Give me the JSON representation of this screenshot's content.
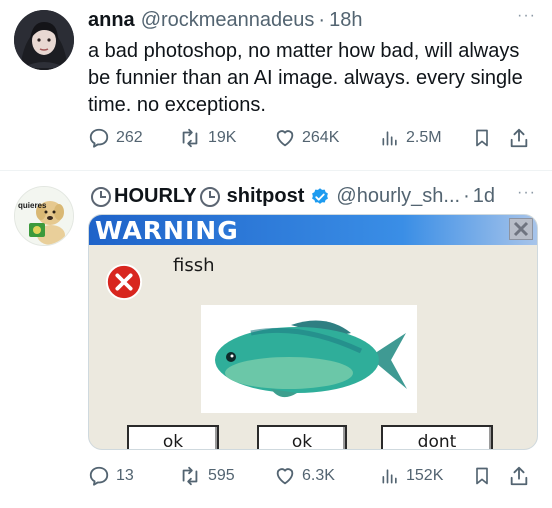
{
  "tweets": [
    {
      "author_name": "anna",
      "author_handle": "@rockmeannadeus",
      "separator": "·",
      "time": "18h",
      "text": "a bad photoshop, no matter how bad, will always be funnier than an AI image. always. every single time. no exceptions.",
      "stats": {
        "replies": "262",
        "retweets": "19K",
        "likes": "264K",
        "views": "2.5M"
      }
    },
    {
      "author_name": "HOURLY",
      "author_name_suffix": "shitpost",
      "author_handle": "@hourly_sh...",
      "separator": "·",
      "time": "1d",
      "avatar_text": "quieres",
      "stats": {
        "replies": "13",
        "retweets": "595",
        "likes": "6.3K",
        "views": "152K"
      },
      "meme": {
        "window_title": "WARNING",
        "message": "fissh",
        "buttons": [
          "ok",
          "ok",
          "dont"
        ]
      }
    }
  ],
  "more_label": "···",
  "colors": {
    "verified": "#1d9bf0",
    "title_bar": "#2a6fd6",
    "error_red": "#d8261f"
  }
}
